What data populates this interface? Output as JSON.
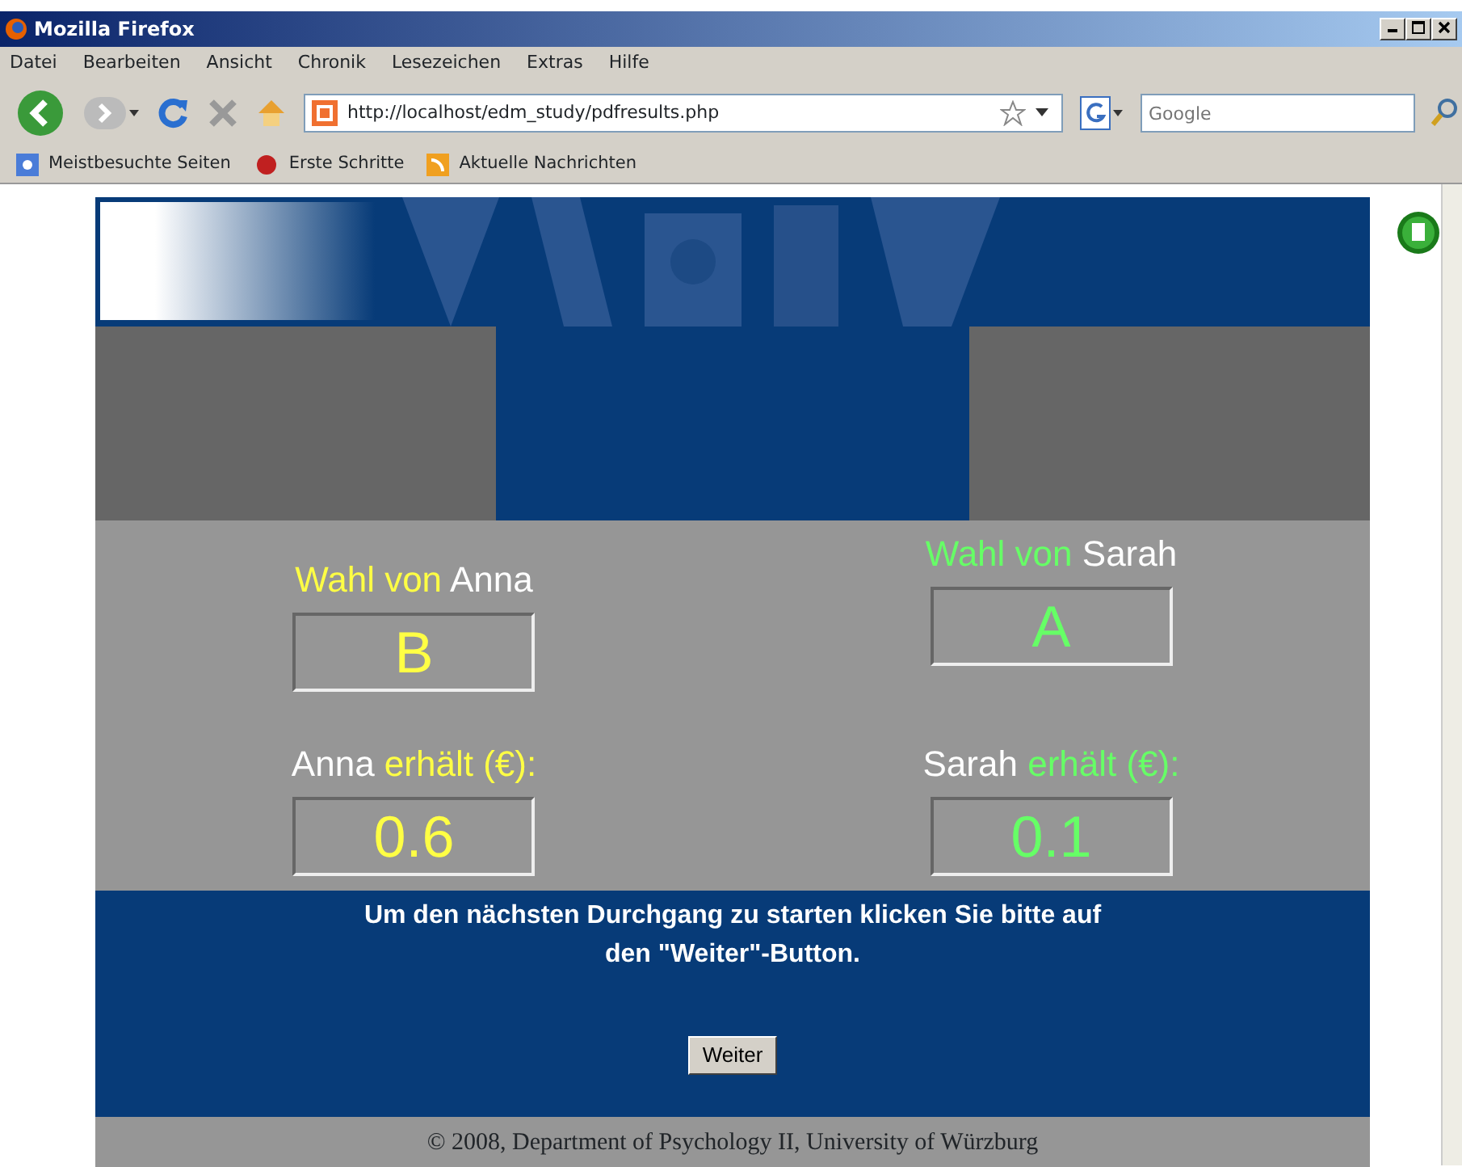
{
  "window": {
    "title": "Mozilla Firefox"
  },
  "menu": [
    "Datei",
    "Bearbeiten",
    "Ansicht",
    "Chronik",
    "Lesezeichen",
    "Extras",
    "Hilfe"
  ],
  "address": {
    "url": "http://localhost/edm_study/pdfresults.php"
  },
  "search": {
    "placeholder": "Google"
  },
  "bookmarks": [
    "Meistbesuchte Seiten",
    "Erste Schritte",
    "Aktuelle Nachrichten"
  ],
  "players": [
    {
      "choice_label": "Wahl von",
      "name": "Anna",
      "choice": "B",
      "received_name": "Anna",
      "received_label": "erhält (€):",
      "amount": "0.6",
      "color": "#ffff44"
    },
    {
      "choice_label": "Wahl von",
      "name": "Sarah",
      "choice": "A",
      "received_name": "Sarah",
      "received_label": "erhält (€):",
      "amount": "0.1",
      "color": "#66ff66"
    }
  ],
  "instruction": "Um den nächsten Durchgang zu starten klicken Sie bitte auf den \"Weiter\"-Button.",
  "button": "Weiter",
  "footer": "© 2008, Department of Psychology II, University of Würzburg"
}
